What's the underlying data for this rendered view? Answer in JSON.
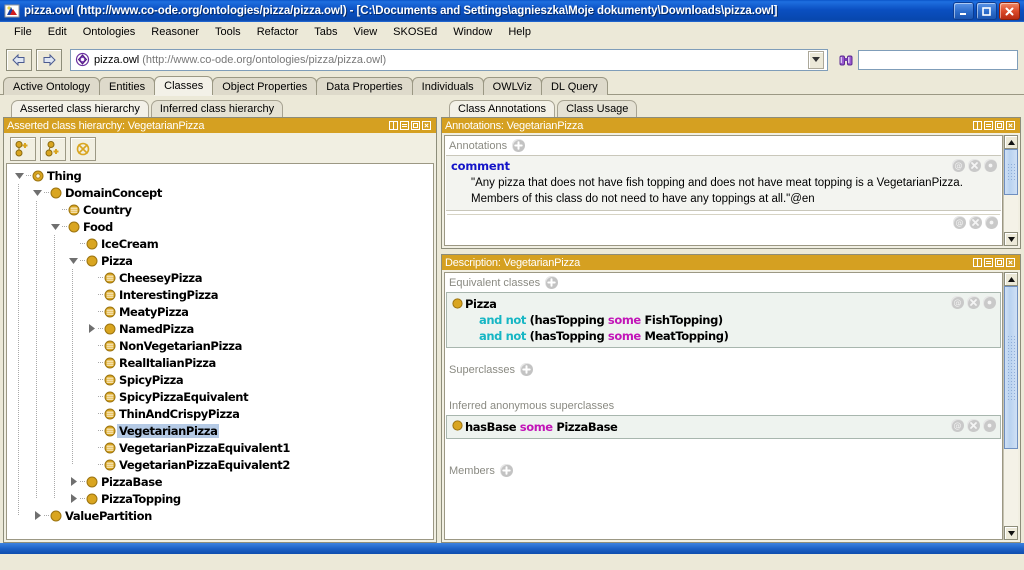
{
  "window": {
    "title": "pizza.owl (http://www.co-ode.org/ontologies/pizza/pizza.owl) - [C:\\Documents and Settings\\agnieszka\\Moje dokumenty\\Downloads\\pizza.owl]",
    "app_icon": "protege-icon",
    "minimize_label": "Minimize",
    "maximize_label": "Maximize",
    "close_label": "Close"
  },
  "menubar": {
    "items": [
      {
        "label": "File"
      },
      {
        "label": "Edit"
      },
      {
        "label": "Ontologies"
      },
      {
        "label": "Reasoner"
      },
      {
        "label": "Tools"
      },
      {
        "label": "Refactor"
      },
      {
        "label": "Tabs"
      },
      {
        "label": "View"
      },
      {
        "label": "SKOSEd"
      },
      {
        "label": "Window"
      },
      {
        "label": "Help"
      }
    ]
  },
  "toolbar": {
    "back_label": "Back",
    "forward_label": "Forward",
    "ontology_icon": "ontology-icon",
    "url_name": "pizza.owl",
    "url_detail": "(http://www.co-ode.org/ontologies/pizza/pizza.owl)",
    "dropdown_label": "Show ontology list",
    "search_icon": "binoculars-icon",
    "search_value": "",
    "search_placeholder": ""
  },
  "main_tabs": [
    {
      "label": "Active Ontology",
      "active": false
    },
    {
      "label": "Entities",
      "active": false
    },
    {
      "label": "Classes",
      "active": true
    },
    {
      "label": "Object Properties",
      "active": false
    },
    {
      "label": "Data Properties",
      "active": false
    },
    {
      "label": "Individuals",
      "active": false
    },
    {
      "label": "OWLViz",
      "active": false
    },
    {
      "label": "DL Query",
      "active": false
    }
  ],
  "left_panel": {
    "tabs": [
      {
        "label": "Asserted class hierarchy",
        "active": true
      },
      {
        "label": "Inferred class hierarchy",
        "active": false
      }
    ],
    "header_title": "Asserted class hierarchy: VegetarianPizza",
    "tools": [
      {
        "name": "add-subclass-button",
        "label": "Add subclass"
      },
      {
        "name": "add-sibling-class-button",
        "label": "Add sibling class"
      },
      {
        "name": "delete-class-button",
        "label": "Delete selected class"
      }
    ],
    "tree": [
      {
        "label": "Thing",
        "depth": 0,
        "icon": "class-root",
        "twisty": "open",
        "selected": false
      },
      {
        "label": "DomainConcept",
        "depth": 1,
        "icon": "class-primitive",
        "twisty": "open",
        "selected": false
      },
      {
        "label": "Country",
        "depth": 2,
        "icon": "class-defined",
        "twisty": "none",
        "selected": false
      },
      {
        "label": "Food",
        "depth": 2,
        "icon": "class-primitive",
        "twisty": "open",
        "selected": false
      },
      {
        "label": "IceCream",
        "depth": 3,
        "icon": "class-primitive",
        "twisty": "none",
        "selected": false
      },
      {
        "label": "Pizza",
        "depth": 3,
        "icon": "class-primitive",
        "twisty": "open",
        "selected": false
      },
      {
        "label": "CheeseyPizza",
        "depth": 4,
        "icon": "class-defined",
        "twisty": "none",
        "selected": false
      },
      {
        "label": "InterestingPizza",
        "depth": 4,
        "icon": "class-defined",
        "twisty": "none",
        "selected": false
      },
      {
        "label": "MeatyPizza",
        "depth": 4,
        "icon": "class-defined",
        "twisty": "none",
        "selected": false
      },
      {
        "label": "NamedPizza",
        "depth": 4,
        "icon": "class-primitive",
        "twisty": "closed",
        "selected": false
      },
      {
        "label": "NonVegetarianPizza",
        "depth": 4,
        "icon": "class-defined",
        "twisty": "none",
        "selected": false
      },
      {
        "label": "RealItalianPizza",
        "depth": 4,
        "icon": "class-defined",
        "twisty": "none",
        "selected": false
      },
      {
        "label": "SpicyPizza",
        "depth": 4,
        "icon": "class-defined",
        "twisty": "none",
        "selected": false
      },
      {
        "label": "SpicyPizzaEquivalent",
        "depth": 4,
        "icon": "class-defined",
        "twisty": "none",
        "selected": false
      },
      {
        "label": "ThinAndCrispyPizza",
        "depth": 4,
        "icon": "class-defined",
        "twisty": "none",
        "selected": false
      },
      {
        "label": "VegetarianPizza",
        "depth": 4,
        "icon": "class-defined",
        "twisty": "none",
        "selected": true
      },
      {
        "label": "VegetarianPizzaEquivalent1",
        "depth": 4,
        "icon": "class-defined",
        "twisty": "none",
        "selected": false
      },
      {
        "label": "VegetarianPizzaEquivalent2",
        "depth": 4,
        "icon": "class-defined",
        "twisty": "none",
        "selected": false
      },
      {
        "label": "PizzaBase",
        "depth": 3,
        "icon": "class-primitive",
        "twisty": "closed",
        "selected": false
      },
      {
        "label": "PizzaTopping",
        "depth": 3,
        "icon": "class-primitive",
        "twisty": "closed",
        "selected": false
      },
      {
        "label": "ValuePartition",
        "depth": 1,
        "icon": "class-primitive",
        "twisty": "closed",
        "selected": false
      }
    ]
  },
  "annotations_panel": {
    "tabs": [
      {
        "label": "Class Annotations",
        "active": true
      },
      {
        "label": "Class Usage",
        "active": false
      }
    ],
    "header_title": "Annotations: VegetarianPizza",
    "section_label": "Annotations",
    "add_label": "Add annotation",
    "rows": [
      {
        "key": "comment",
        "value": "\"Any pizza that does not have fish topping and does not have meat topping is a VegetarianPizza. Members of this class do not need to have any toppings at all.\"@en",
        "actions": [
          "annotation-icon",
          "delete-icon",
          "edit-icon"
        ]
      }
    ]
  },
  "description_panel": {
    "header_title": "Description: VegetarianPizza",
    "sections": [
      {
        "label": "Equivalent classes",
        "has_add": true,
        "rows": [
          {
            "icon": "class-primitive",
            "lines": [
              {
                "tokens": [
                  {
                    "t": "Pizza",
                    "c": "plain"
                  }
                ]
              },
              {
                "indent": true,
                "tokens": [
                  {
                    "t": "and",
                    "c": "kw-and"
                  },
                  {
                    "t": "not",
                    "c": "kw-not"
                  },
                  {
                    "t": "(hasTopping",
                    "c": "plain"
                  },
                  {
                    "t": "some",
                    "c": "kw-some"
                  },
                  {
                    "t": "FishTopping)",
                    "c": "plain"
                  }
                ]
              },
              {
                "indent": true,
                "tokens": [
                  {
                    "t": "and",
                    "c": "kw-and"
                  },
                  {
                    "t": "not",
                    "c": "kw-not"
                  },
                  {
                    "t": "(hasTopping",
                    "c": "plain"
                  },
                  {
                    "t": "some",
                    "c": "kw-some"
                  },
                  {
                    "t": "MeatTopping)",
                    "c": "plain"
                  }
                ]
              }
            ],
            "actions": [
              "annotation-icon",
              "delete-icon",
              "edit-icon"
            ]
          }
        ]
      },
      {
        "label": "Superclasses",
        "has_add": true,
        "rows": []
      },
      {
        "label": "Inferred anonymous superclasses",
        "has_add": false,
        "rows": [
          {
            "icon": "class-primitive",
            "lines": [
              {
                "tokens": [
                  {
                    "t": "hasBase",
                    "c": "plain"
                  },
                  {
                    "t": "some",
                    "c": "kw-some"
                  },
                  {
                    "t": "PizzaBase",
                    "c": "plain"
                  }
                ]
              }
            ],
            "actions": [
              "annotation-icon",
              "delete-icon",
              "edit-icon"
            ]
          }
        ]
      },
      {
        "label": "Members",
        "has_add": true,
        "rows": []
      }
    ]
  },
  "colors": {
    "panel_header": "#D5A021",
    "titlebar_blue": "#0A4FC0",
    "selection_blue": "#b5cae5",
    "class_orange": "#D9A520",
    "keyword_cyan": "#16b6c4",
    "keyword_magenta": "#c215b8",
    "annotation_key_blue": "#1414c8",
    "desktop_beige": "#ece9d8"
  }
}
